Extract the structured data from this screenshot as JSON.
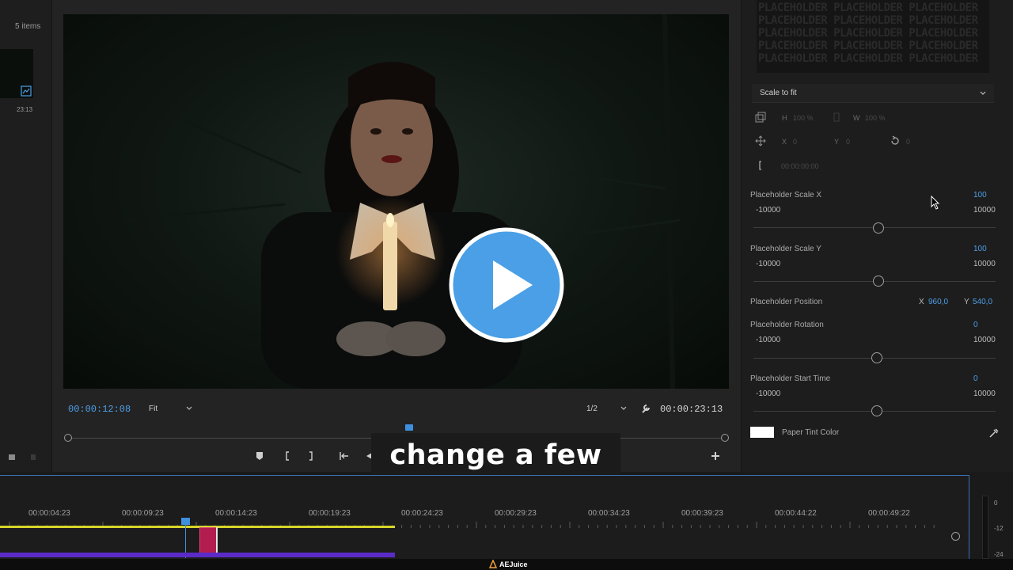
{
  "project": {
    "items_count": "5 items",
    "clip_duration": "23:13"
  },
  "monitor": {
    "current_timecode": "00:00:12:08",
    "zoom": "Fit",
    "resolution": "1/2",
    "duration_timecode": "00:00:23:13"
  },
  "caption": {
    "text": "change a few"
  },
  "effect_controls": {
    "placeholder_text": "PLACEHOLDER PLACEHOLDER PLACEHOLDER",
    "scale_mode": "Scale to fit",
    "transform": {
      "h_label": "H",
      "h_value": "100 %",
      "w_label": "W",
      "w_value": "100 %",
      "x_label": "X",
      "x_value": "0",
      "y_label": "Y",
      "y_value": "0",
      "rotate_value": "0",
      "time_value": "00:00:00:00"
    },
    "params": [
      {
        "name": "Placeholder Scale X",
        "value": "100",
        "min": "-10000",
        "max": "10000",
        "slider_fraction": 0.51
      },
      {
        "name": "Placeholder Scale Y",
        "value": "100",
        "min": "-10000",
        "max": "10000",
        "slider_fraction": 0.51
      },
      {
        "name": "Placeholder Rotation",
        "value": "0",
        "min": "-10000",
        "max": "10000",
        "slider_fraction": 0.5
      },
      {
        "name": "Placeholder Start Time",
        "value": "0",
        "min": "-10000",
        "max": "10000",
        "slider_fraction": 0.5
      }
    ],
    "position": {
      "name": "Placeholder Position",
      "x_label": "X",
      "x_value": "960,0",
      "y_label": "Y",
      "y_value": "540,0"
    },
    "tint": {
      "name": "Paper Tint Color",
      "color": "#ffffff"
    }
  },
  "timeline": {
    "ruler": [
      "00:00:04:23",
      "00:00:09:23",
      "00:00:14:23",
      "00:00:19:23",
      "00:00:24:23",
      "00:00:29:23",
      "00:00:34:23",
      "00:00:39:23",
      "00:00:44:22",
      "00:00:49:22"
    ],
    "colors": {
      "workarea": "#d6d62a",
      "clip": "#b21c4f",
      "track": "#5b2bc7",
      "playhead": "#3f8fe0"
    }
  },
  "meters": {
    "labels": [
      "0",
      "-12",
      "-24"
    ]
  },
  "brand": {
    "name": "AEJuice"
  },
  "accent": "#4d9fe8"
}
